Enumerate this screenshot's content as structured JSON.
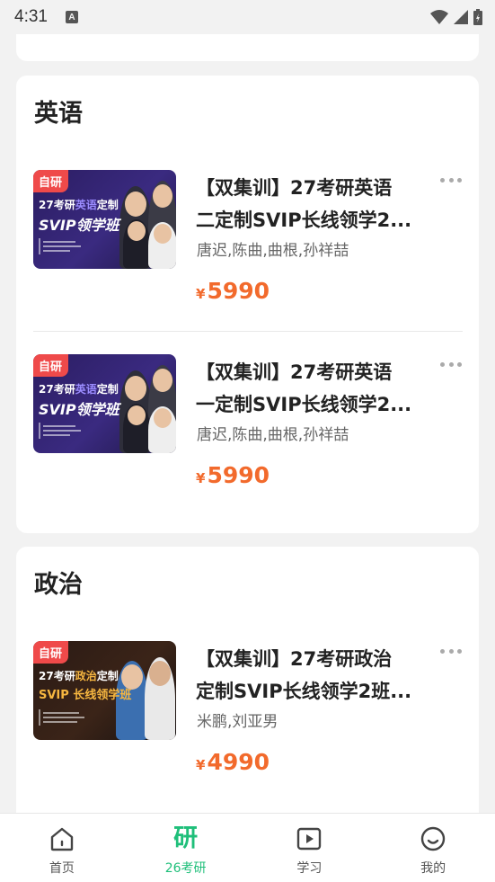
{
  "status": {
    "time": "4:31"
  },
  "sections": [
    {
      "title": "英语",
      "courses": [
        {
          "title_line1": "【双集训】27考研英语",
          "title_line2": "二定制SVIP长线领学2...",
          "teachers": "唐迟,陈曲,曲根,孙祥喆",
          "price_symbol": "¥",
          "price": "5990",
          "thumb": {
            "tag": "自研",
            "line1_a": "27考研",
            "line1_b": "英语",
            "line1_c": "定制",
            "line2": "SVIP领学班"
          }
        },
        {
          "title_line1": "【双集训】27考研英语",
          "title_line2": "一定制SVIP长线领学2...",
          "teachers": "唐迟,陈曲,曲根,孙祥喆",
          "price_symbol": "¥",
          "price": "5990",
          "thumb": {
            "tag": "自研",
            "line1_a": "27考研",
            "line1_b": "英语",
            "line1_c": "定制",
            "line2": "SVIP领学班"
          }
        }
      ]
    },
    {
      "title": "政治",
      "courses": [
        {
          "title_line1": "【双集训】27考研政治",
          "title_line2": "定制SVIP长线领学2班...",
          "teachers": "米鹏,刘亚男",
          "price_symbol": "¥",
          "price": "4990",
          "thumb": {
            "tag": "自研",
            "line1_a": "27考研",
            "line1_b": "政治",
            "line1_c": "定制",
            "line2": "SVIP 长线领学班"
          }
        }
      ]
    }
  ],
  "tabbar": {
    "items": [
      {
        "label": "首页",
        "icon": "home-icon"
      },
      {
        "label": "26考研",
        "icon_text": "研"
      },
      {
        "label": "学习",
        "icon": "play-icon"
      },
      {
        "label": "我的",
        "icon": "smile-icon"
      }
    ],
    "active_color": "#1fbf7a"
  },
  "colors": {
    "price": "#f26a2c",
    "accent": "#1fbf7a",
    "tag": "#ef4a4a"
  }
}
